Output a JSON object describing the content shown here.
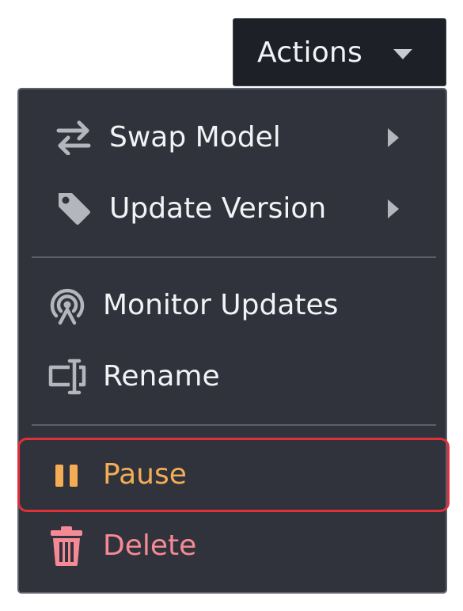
{
  "actions_button": {
    "label": "Actions",
    "icon": "caret-down-icon"
  },
  "menu": {
    "items": [
      {
        "label": "Swap Model",
        "icon": "swap-arrows-icon",
        "has_submenu": true
      },
      {
        "label": "Update Version",
        "icon": "tag-icon",
        "has_submenu": true
      },
      {
        "label": "Monitor Updates",
        "icon": "broadcast-icon",
        "has_submenu": false
      },
      {
        "label": "Rename",
        "icon": "rename-cursor-icon",
        "has_submenu": false
      },
      {
        "label": "Pause",
        "icon": "pause-icon",
        "has_submenu": false,
        "highlighted": true
      },
      {
        "label": "Delete",
        "icon": "trash-icon",
        "has_submenu": false
      }
    ]
  },
  "colors": {
    "menu_background": "#30333c",
    "button_background": "#1e2027",
    "text": "#f2f3f5",
    "icon_gray": "#b3b6bd",
    "pause_accent": "#f4ad55",
    "delete_accent": "#f58a95",
    "highlight_border": "#e0303a"
  }
}
